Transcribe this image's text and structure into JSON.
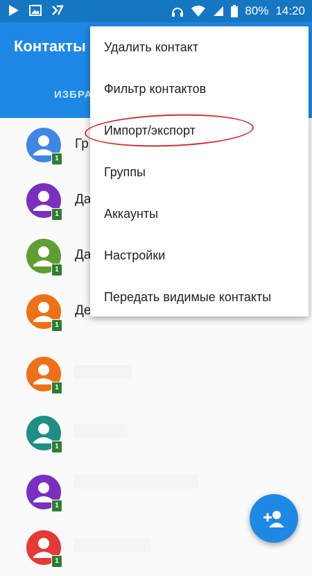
{
  "status_bar": {
    "battery": "80%",
    "time": "14:20"
  },
  "app_bar": {
    "title": "Контакты",
    "tab_label": "ИЗБРА"
  },
  "contacts": [
    {
      "name_fragment": "Гр",
      "color": "#3f86e6",
      "badge": "1"
    },
    {
      "name_fragment": "Да",
      "color": "#7b2fc1",
      "badge": "1"
    },
    {
      "name_fragment": "Да",
      "color": "#5f9e32",
      "badge": "1"
    },
    {
      "name_fragment": "Де",
      "color": "#ef7016",
      "badge": "1"
    },
    {
      "name_fragment": "",
      "color": "#ef7016",
      "badge": "1"
    },
    {
      "name_fragment": "",
      "color": "#1e8f84",
      "badge": "1"
    },
    {
      "name_fragment": "",
      "color": "#7b2fc1",
      "badge": "1"
    },
    {
      "name_fragment": "",
      "color": "#e53935",
      "badge": "1"
    }
  ],
  "menu": {
    "items": [
      "Удалить контакт",
      "Фильтр контактов",
      "Импорт/экспорт",
      "Группы",
      "Аккаунты",
      "Настройки",
      "Передать видимые контакты"
    ]
  },
  "colors": {
    "status_bar": "#1576c2",
    "app_bar": "#1e88e5",
    "highlight_ellipse": "#d32f2f",
    "fab": "#1e88e5"
  },
  "icons": {
    "fab": "add-contact-icon"
  }
}
